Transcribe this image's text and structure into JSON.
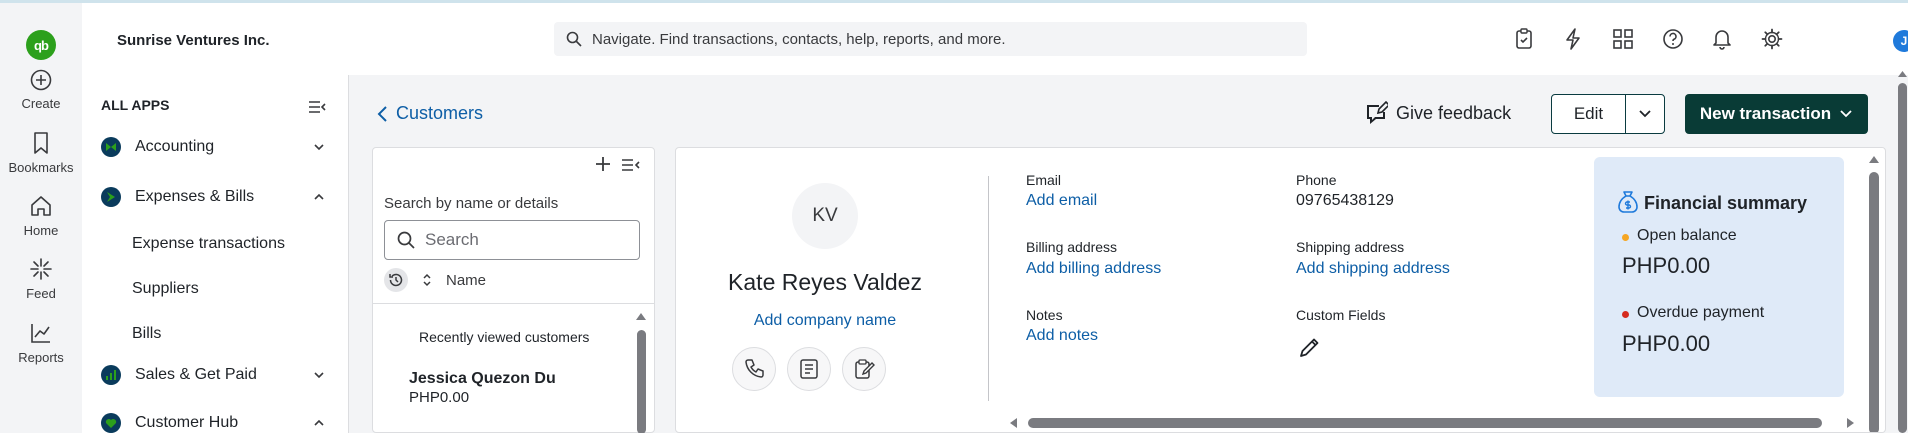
{
  "rail": {
    "items": [
      {
        "label": "Create",
        "icon": "plus-circle-icon"
      },
      {
        "label": "Bookmarks",
        "icon": "bookmark-icon"
      },
      {
        "label": "Home",
        "icon": "home-icon"
      },
      {
        "label": "Feed",
        "icon": "feed-icon"
      },
      {
        "label": "Reports",
        "icon": "chart-icon"
      }
    ],
    "logo_text": "qb"
  },
  "topbar": {
    "company": "Sunrise Ventures Inc.",
    "search_placeholder": "Navigate. Find transactions, contacts, help, reports, and more.",
    "avatar": "J"
  },
  "appnav": {
    "heading": "ALL APPS",
    "items": [
      {
        "label": "Accounting",
        "expanded": false
      },
      {
        "label": "Expenses & Bills",
        "expanded": true
      },
      {
        "label": "Sales & Get Paid",
        "expanded": false
      },
      {
        "label": "Customer Hub",
        "expanded": true
      }
    ],
    "subitems": [
      "Expense transactions",
      "Suppliers",
      "Bills"
    ]
  },
  "header": {
    "back_label": "Customers",
    "feedback_label": "Give feedback",
    "edit_label": "Edit",
    "new_transaction_label": "New transaction"
  },
  "customer_list": {
    "search_hint": "Search by name or details",
    "search_placeholder": "Search",
    "sort_label": "Name",
    "recent_heading": "Recently viewed customers",
    "recent": [
      {
        "name": "Jessica Quezon Du",
        "balance": "PHP0.00"
      }
    ]
  },
  "customer": {
    "initials": "KV",
    "name": "Kate Reyes Valdez",
    "add_company": "Add company name",
    "email_label": "Email",
    "email_action": "Add email",
    "phone_label": "Phone",
    "phone_value": "09765438129",
    "billing_label": "Billing address",
    "billing_action": "Add billing address",
    "shipping_label": "Shipping address",
    "shipping_action": "Add shipping address",
    "notes_label": "Notes",
    "notes_action": "Add notes",
    "custom_fields_label": "Custom Fields"
  },
  "financial_summary": {
    "title": "Financial summary",
    "open_label": "Open balance",
    "open_value": "PHP0.00",
    "overdue_label": "Overdue payment",
    "overdue_value": "PHP0.00",
    "open_color": "#f5a623",
    "overdue_color": "#d52b1e"
  },
  "colors": {
    "brand_green": "#2ca01c",
    "primary_dark": "#093b36",
    "link_blue": "#0d5ea6"
  }
}
